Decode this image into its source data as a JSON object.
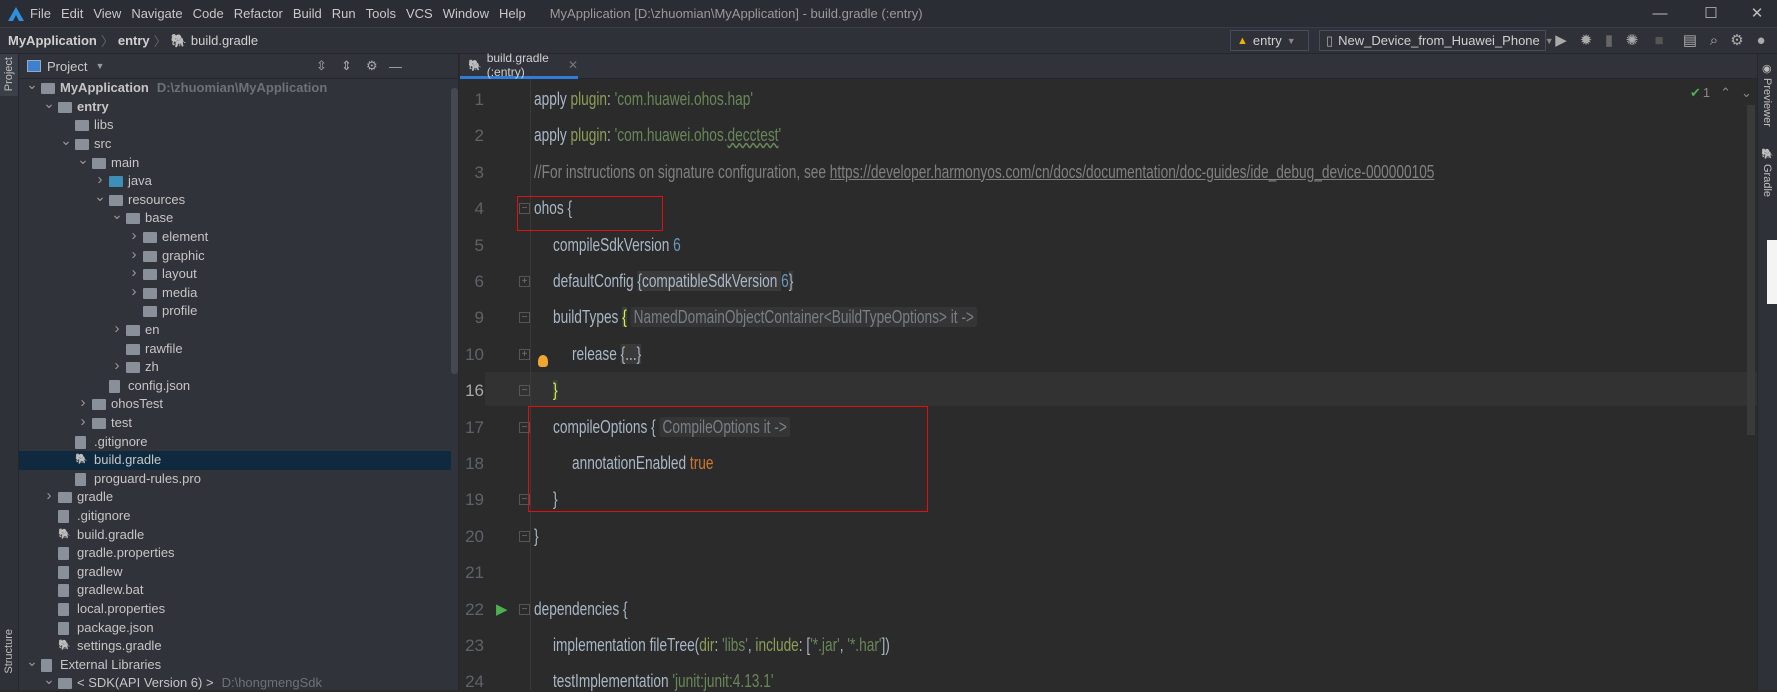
{
  "window": {
    "title": "MyApplication [D:\\zhuomian\\MyApplication] - build.gradle (:entry)",
    "menu": [
      "File",
      "Edit",
      "View",
      "Navigate",
      "Code",
      "Refactor",
      "Build",
      "Run",
      "Tools",
      "VCS",
      "Window",
      "Help"
    ],
    "controls": {
      "minimize": "—",
      "maximize": "☐",
      "close": "✕"
    }
  },
  "breadcrumb": [
    "MyApplication",
    "entry",
    "build.gradle"
  ],
  "toolbar": {
    "module_select": "entry",
    "device_select": "New_Device_from_Huawei_Phone",
    "icons": [
      "run-icon",
      "debug-icon",
      "attach-debugger-icon",
      "profile-icon",
      "stop-icon",
      "project-structure-icon",
      "search-icon",
      "settings-icon",
      "account-icon"
    ]
  },
  "left_strip": {
    "top": "Project",
    "bottom": "Structure"
  },
  "right_strip": {
    "top": "Previewer",
    "bottom": "Gradle"
  },
  "project_panel": {
    "title": "Project",
    "tree": [
      {
        "level": 0,
        "name": "MyApplication",
        "type": "module",
        "exp": "open",
        "bold": true,
        "path": "D:\\zhuomian\\MyApplication"
      },
      {
        "level": 1,
        "name": "entry",
        "type": "module",
        "exp": "open",
        "bold": true
      },
      {
        "level": 2,
        "name": "libs",
        "type": "folder"
      },
      {
        "level": 2,
        "name": "src",
        "type": "folder",
        "exp": "open"
      },
      {
        "level": 3,
        "name": "main",
        "type": "folder",
        "exp": "open"
      },
      {
        "level": 4,
        "name": "java",
        "type": "java",
        "exp": "closed"
      },
      {
        "level": 4,
        "name": "resources",
        "type": "folder",
        "exp": "open"
      },
      {
        "level": 5,
        "name": "base",
        "type": "folder",
        "exp": "open"
      },
      {
        "level": 6,
        "name": "element",
        "type": "folder",
        "exp": "closed"
      },
      {
        "level": 6,
        "name": "graphic",
        "type": "folder",
        "exp": "closed"
      },
      {
        "level": 6,
        "name": "layout",
        "type": "folder",
        "exp": "closed"
      },
      {
        "level": 6,
        "name": "media",
        "type": "folder",
        "exp": "closed"
      },
      {
        "level": 6,
        "name": "profile",
        "type": "folder"
      },
      {
        "level": 5,
        "name": "en",
        "type": "folder",
        "exp": "closed"
      },
      {
        "level": 5,
        "name": "rawfile",
        "type": "folder"
      },
      {
        "level": 5,
        "name": "zh",
        "type": "folder",
        "exp": "closed"
      },
      {
        "level": 4,
        "name": "config.json",
        "type": "file"
      },
      {
        "level": 3,
        "name": "ohosTest",
        "type": "folder",
        "exp": "closed"
      },
      {
        "level": 3,
        "name": "test",
        "type": "folder",
        "exp": "closed"
      },
      {
        "level": 2,
        "name": ".gitignore",
        "type": "file"
      },
      {
        "level": 2,
        "name": "build.gradle",
        "type": "gradle",
        "selected": true
      },
      {
        "level": 2,
        "name": "proguard-rules.pro",
        "type": "file"
      },
      {
        "level": 1,
        "name": "gradle",
        "type": "folder",
        "exp": "closed"
      },
      {
        "level": 1,
        "name": ".gitignore",
        "type": "file"
      },
      {
        "level": 1,
        "name": "build.gradle",
        "type": "gradle"
      },
      {
        "level": 1,
        "name": "gradle.properties",
        "type": "file"
      },
      {
        "level": 1,
        "name": "gradlew",
        "type": "file"
      },
      {
        "level": 1,
        "name": "gradlew.bat",
        "type": "file"
      },
      {
        "level": 1,
        "name": "local.properties",
        "type": "file"
      },
      {
        "level": 1,
        "name": "package.json",
        "type": "file"
      },
      {
        "level": 1,
        "name": "settings.gradle",
        "type": "gradle"
      },
      {
        "level": 0,
        "name": "External Libraries",
        "type": "libs",
        "exp": "open"
      },
      {
        "level": 1,
        "name": "< SDK(API Version 6) >",
        "type": "folder",
        "exp": "open",
        "path": "D:\\hongmengSdk"
      }
    ]
  },
  "editor": {
    "tab": "build.gradle (:entry)",
    "inspection_count": "1",
    "current_line": "16",
    "lines": [
      {
        "n": "1",
        "indent": 0,
        "t": [
          [
            "kw",
            "apply "
          ],
          [
            "attr",
            "plugin"
          ],
          [
            "kw",
            ": "
          ],
          [
            "str",
            "'com.huawei.ohos.hap'"
          ]
        ]
      },
      {
        "n": "2",
        "indent": 0,
        "t": [
          [
            "kw",
            "apply "
          ],
          [
            "attr",
            "plugin"
          ],
          [
            "kw",
            ": "
          ],
          [
            "str",
            "'com.huawei.ohos."
          ],
          [
            "str wavy",
            "decctest"
          ],
          [
            "str",
            "'"
          ]
        ]
      },
      {
        "n": "3",
        "indent": 0,
        "t": [
          [
            "cmt",
            "//For instructions on signature configuration, see "
          ],
          [
            "link",
            "https://developer.harmonyos.com/cn/docs/documentation/doc-guides/ide_debug_device-000000105"
          ]
        ]
      },
      {
        "n": "4",
        "indent": 0,
        "fold": "−",
        "t": [
          [
            "kw",
            "ohos {"
          ]
        ]
      },
      {
        "n": "5",
        "indent": 1,
        "t": [
          [
            "kw",
            "compileSdkVersion "
          ],
          [
            "num",
            "6"
          ]
        ]
      },
      {
        "n": "6",
        "indent": 1,
        "fold": "+",
        "t": [
          [
            "kw",
            "defaultConfig "
          ],
          [
            "foldtxt",
            "{compatibleSdkVersion "
          ],
          [
            "num",
            "6"
          ],
          [
            "foldtxt",
            "}"
          ]
        ]
      },
      {
        "n": "9",
        "indent": 1,
        "fold": "−",
        "t": [
          [
            "kw",
            "buildTypes "
          ],
          [
            "brace",
            "{"
          ],
          [
            "kw",
            " "
          ],
          [
            "hint",
            "NamedDomainObjectContainer<BuildTypeOptions> it ->"
          ]
        ]
      },
      {
        "n": "10",
        "indent": 2,
        "fold": "+",
        "bulb": true,
        "t": [
          [
            "kw",
            "release "
          ],
          [
            "foldtxt",
            "{...}"
          ]
        ]
      },
      {
        "n": "16",
        "indent": 1,
        "fold": "−",
        "t": [
          [
            "brace",
            "}"
          ]
        ]
      },
      {
        "n": "17",
        "indent": 1,
        "fold": "−",
        "t": [
          [
            "kw",
            "compileOptions { "
          ],
          [
            "hint",
            "CompileOptions it ->"
          ]
        ]
      },
      {
        "n": "18",
        "indent": 2,
        "t": [
          [
            "kw",
            "annotationEnabled "
          ],
          [
            "bool",
            "true"
          ]
        ]
      },
      {
        "n": "19",
        "indent": 1,
        "fold": "−",
        "t": [
          [
            "kw",
            "}"
          ]
        ]
      },
      {
        "n": "20",
        "indent": 0,
        "fold": "−",
        "t": [
          [
            "kw",
            "}"
          ]
        ]
      },
      {
        "n": "21",
        "indent": 0,
        "t": []
      },
      {
        "n": "22",
        "indent": 0,
        "fold": "−",
        "run": true,
        "t": [
          [
            "kw",
            "dependencies {"
          ]
        ]
      },
      {
        "n": "23",
        "indent": 1,
        "t": [
          [
            "kw",
            "implementation fileTree("
          ],
          [
            "attr",
            "dir"
          ],
          [
            "kw",
            ": "
          ],
          [
            "str",
            "'libs'"
          ],
          [
            "kw",
            ", "
          ],
          [
            "attr",
            "include"
          ],
          [
            "kw",
            ": ["
          ],
          [
            "str",
            "'*.jar'"
          ],
          [
            "kw",
            ", "
          ],
          [
            "str",
            "'*.har'"
          ],
          [
            "kw",
            "])"
          ]
        ]
      },
      {
        "n": "24",
        "indent": 1,
        "t": [
          [
            "kw",
            "testImplementation "
          ],
          [
            "str",
            "'junit:junit:4.13.1'"
          ]
        ]
      }
    ]
  },
  "colors": {
    "annotation_box": "#e01010",
    "selection": "#0f2a3f",
    "accent": "#2f7dd6"
  }
}
